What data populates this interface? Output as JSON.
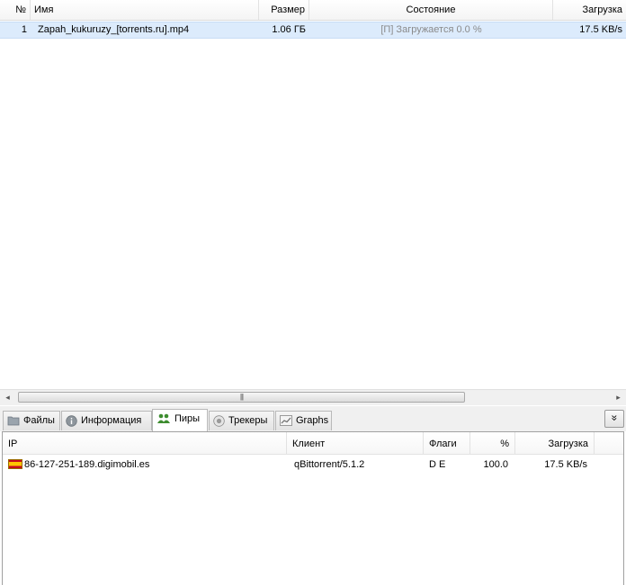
{
  "torrents": {
    "columns": {
      "num": "№",
      "name": "Имя",
      "size": "Размер",
      "state": "Состояние",
      "download": "Загрузка"
    },
    "rows": [
      {
        "num": "1",
        "name": "Zapah_kukuruzy_[torrents.ru].mp4",
        "size": "1.06 ГБ",
        "state": "[П] Загружается 0.0 %",
        "download": "17.5 KB/s"
      }
    ]
  },
  "scrollbar": {
    "left_arrow": "◂",
    "right_arrow": "▸",
    "grip": "|||"
  },
  "tabs": [
    {
      "label": "Файлы",
      "icon": "folder-icon"
    },
    {
      "label": "Информация",
      "icon": "info-icon"
    },
    {
      "label": "Пиры",
      "icon": "users-icon",
      "active": true
    },
    {
      "label": "Трекеры",
      "icon": "tracker-icon"
    },
    {
      "label": "Graphs",
      "icon": "graph-icon"
    }
  ],
  "tab_menu_glyph": "»",
  "peers": {
    "columns": {
      "ip": "IP",
      "client": "Клиент",
      "flags": "Флаги",
      "percent": "%",
      "download": "Загрузка"
    },
    "rows": [
      {
        "country_flag": "spain-flag-icon",
        "ip": "86-127-251-189.digimobil.es",
        "client": "qBittorrent/5.1.2",
        "flags": "D E",
        "percent": "100.0",
        "download": "17.5 KB/s"
      }
    ]
  },
  "colors": {
    "selected_row": "#dcebfc",
    "status_text": "#8a8a8a",
    "tab_icon_green": "#3d8c2f"
  }
}
